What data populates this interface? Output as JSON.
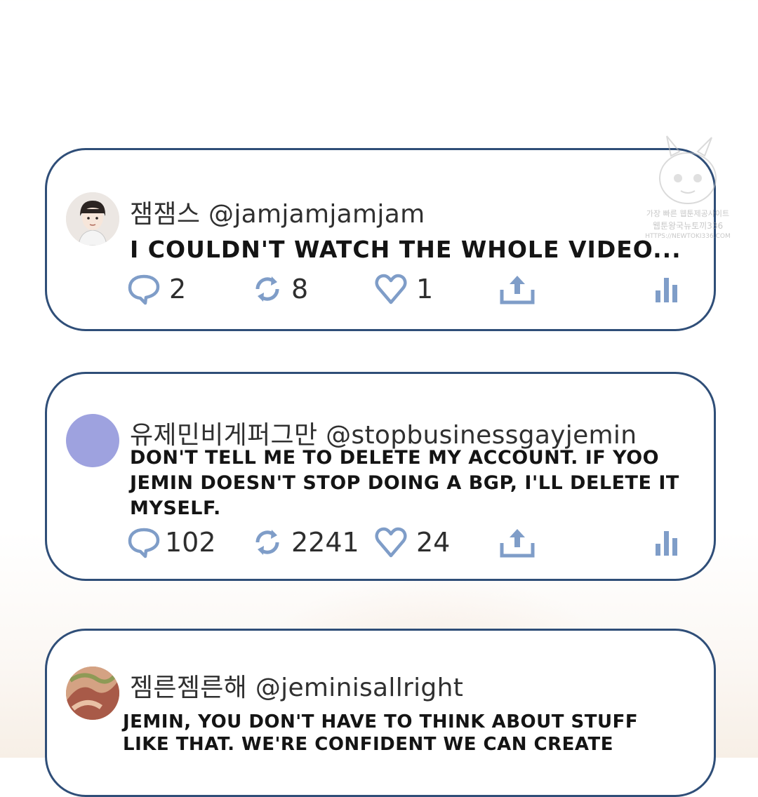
{
  "watermark": {
    "line1": "가장 빠른 웹툰제공사이트",
    "line2": "웹툰왕국뉴토끼336",
    "line3": "HTTPS://NEWTOKI336.COM"
  },
  "colors": {
    "card_border": "#2f4e78",
    "icon": "#7f9dc8",
    "avatar_2": "#9ea2df"
  },
  "tweets": [
    {
      "display_name": "잼잼스",
      "handle": "@jamjamjamjam",
      "text": "I couldn't watch the whole video...",
      "replies": "2",
      "retweets": "8",
      "likes": "1",
      "icons": [
        "reply-icon",
        "retweet-icon",
        "like-icon",
        "share-icon",
        "stats-icon"
      ]
    },
    {
      "display_name": "유제민비게퍼그만",
      "handle": "@stopbusinessgayjemin",
      "text": "Don't tell me to delete my account. If Yoo Jemin doesn't stop doing a BGP, I'll delete it myself.",
      "replies": "102",
      "retweets": "2241",
      "likes": "24",
      "icons": [
        "reply-icon",
        "retweet-icon",
        "like-icon",
        "share-icon",
        "stats-icon"
      ]
    },
    {
      "display_name": "젬른젬른해",
      "handle": "@jeminisallright",
      "text": "Jemin, you don't have to think about stuff like that. We're confident we can create"
    }
  ]
}
